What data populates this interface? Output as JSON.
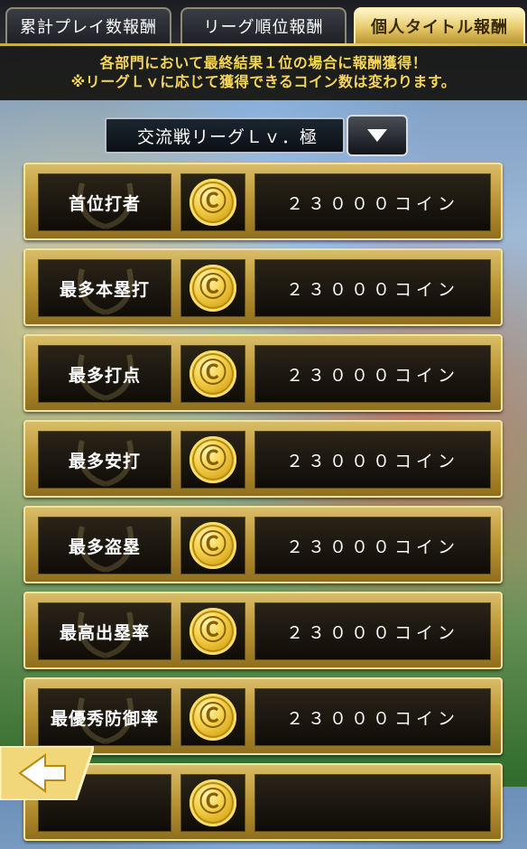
{
  "tabs": [
    {
      "label": "累計プレイ数報酬",
      "active": false
    },
    {
      "label": "リーグ順位報酬",
      "active": false
    },
    {
      "label": "個人タイトル報酬",
      "active": true
    }
  ],
  "notice": {
    "line1": "各部門において最終結果１位の場合に報酬獲得！",
    "line2": "※リーグＬｖに応じて獲得できるコイン数は変わります。"
  },
  "league_select": {
    "value": "交流戦リーグＬｖ．極",
    "icon": "chevron-down-icon"
  },
  "rewards": [
    {
      "title": "首位打者",
      "amount": "２３０００コイン"
    },
    {
      "title": "最多本塁打",
      "amount": "２３０００コイン"
    },
    {
      "title": "最多打点",
      "amount": "２３０００コイン"
    },
    {
      "title": "最多安打",
      "amount": "２３０００コイン"
    },
    {
      "title": "最多盗塁",
      "amount": "２３０００コイン"
    },
    {
      "title": "最高出塁率",
      "amount": "２３０００コイン"
    },
    {
      "title": "最優秀防御率",
      "amount": "２３０００コイン"
    },
    {
      "title": "",
      "amount": ""
    }
  ],
  "coin_glyph": "Ⓒ",
  "colors": {
    "notice_text": "#f5d55a",
    "row_gold": "#b99435",
    "active_tab": "#e6c96a"
  }
}
